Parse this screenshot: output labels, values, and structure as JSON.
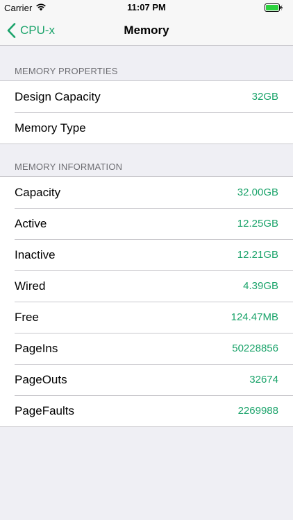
{
  "status_bar": {
    "carrier": "Carrier",
    "time": "11:07 PM"
  },
  "nav": {
    "back_label": "CPU-x",
    "title": "Memory"
  },
  "accent_color": "#1aa36a",
  "sections": [
    {
      "header": "MEMORY PROPERTIES",
      "rows": [
        {
          "label": "Design Capacity",
          "value": "32GB"
        },
        {
          "label": "Memory Type",
          "value": ""
        }
      ]
    },
    {
      "header": "MEMORY INFORMATION",
      "rows": [
        {
          "label": "Capacity",
          "value": "32.00GB"
        },
        {
          "label": "Active",
          "value": "12.25GB"
        },
        {
          "label": "Inactive",
          "value": "12.21GB"
        },
        {
          "label": "Wired",
          "value": "4.39GB"
        },
        {
          "label": "Free",
          "value": "124.47MB"
        },
        {
          "label": "PageIns",
          "value": "50228856"
        },
        {
          "label": "PageOuts",
          "value": "32674"
        },
        {
          "label": "PageFaults",
          "value": "2269988"
        }
      ]
    }
  ]
}
